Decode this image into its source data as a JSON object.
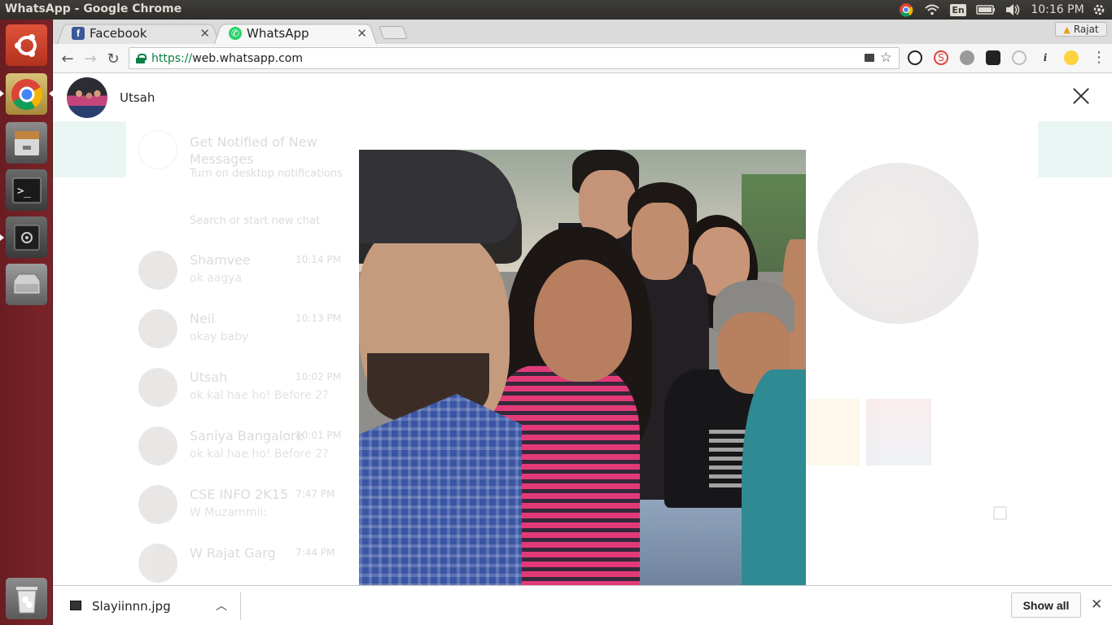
{
  "window_title": "WhatsApp - Google Chrome",
  "system_tray": {
    "keyboard_layout": "En",
    "clock": "10:16 PM"
  },
  "tabs": [
    {
      "label": "Facebook",
      "icon": "facebook-icon"
    },
    {
      "label": "WhatsApp",
      "icon": "whatsapp-icon",
      "active": true
    }
  ],
  "profile_name": "Rajat",
  "address_bar": {
    "scheme": "https://",
    "host": "web.whatsapp.com"
  },
  "media_viewer": {
    "sender_name": "Utsah"
  },
  "background_chat_list": {
    "notification_title": "Get Notified of New Messages",
    "notification_subtitle": "Turn on desktop notifications",
    "search_placeholder": "Search or start new chat",
    "chats": [
      {
        "name": "Shamvee",
        "time": "10:14 PM",
        "message": "ok aagya"
      },
      {
        "name": "Neil",
        "time": "10:13 PM",
        "message": "okay baby"
      },
      {
        "name": "Utsah",
        "time": "10:02 PM",
        "message": "ok kal hae ho! Before 2?"
      },
      {
        "name": "Saniya Bangalore",
        "time": "10:01 PM",
        "message": "ok kal hae ho! Before 2?"
      },
      {
        "name": "CSE INFO 2K15",
        "time": "7:47 PM",
        "message": "W Muzammil:"
      },
      {
        "name": "W Rajat Garg",
        "time": "7:44 PM",
        "message": ""
      }
    ]
  },
  "download_bar": {
    "filename": "Slayiinnn.jpg",
    "show_all_label": "Show all"
  },
  "colors": {
    "launcher": "#7a2328",
    "secure_green": "#0b8043",
    "whatsapp_green": "#25d366",
    "facebook_blue": "#3b5998"
  }
}
